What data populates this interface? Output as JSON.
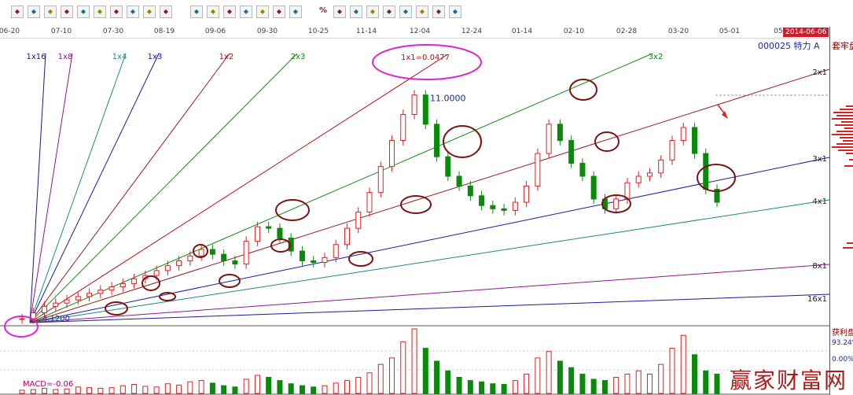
{
  "toolbar": {
    "icons": [
      "chart-toggle-icon",
      "fan-line-icon",
      "arrow-icon",
      "pointer-icon",
      "diamond-icon",
      "diamond-icon",
      "diamond-icon",
      "diamond-icon",
      "diamond-icon",
      "cycle-icon",
      "grid-icon",
      "line-tool-icon",
      "parallel-icon",
      "channel-icon",
      "ellipse-icon",
      "fibonacci-icon",
      "gann-icon",
      "percent-icon",
      "text-icon",
      "target-icon",
      "palette-icon",
      "price-tag-icon",
      "rise-icon",
      "fall-icon",
      "erase-icon",
      "lock-icon"
    ],
    "percent_label": "%"
  },
  "date_axis": {
    "labels": [
      "06-20",
      "07-10",
      "07-30",
      "08-19",
      "09-06",
      "09-30",
      "10-25",
      "11-14",
      "12-04",
      "12-24",
      "01-14",
      "02-10",
      "02-28",
      "03-20",
      "05-01",
      "05"
    ],
    "current_date": "2014-06-06"
  },
  "stock": {
    "code_name": "000025  特力 A"
  },
  "right_panel": {
    "title": "套牢盘",
    "title2": "获利盘",
    "pct1": "93.24%",
    "pct2": "0.00%"
  },
  "macd": {
    "label": "MACD=-0.06"
  },
  "watermark": "赢家财富网",
  "colors": {
    "up": "#e02020",
    "down": "#0a8a0a",
    "annot_circle": "#7a1414",
    "origin_circle": "#e020e0"
  },
  "chart_data": {
    "type": "candlestick-gann-fan",
    "note_labels": {
      "peak_price": "11.0000",
      "origin_price": "4.1200",
      "fan_main": "1x1=0.0477",
      "fan_upper": [
        "1x16",
        "1x8",
        "1x4",
        "1x3",
        "1x2",
        "2x3",
        "3x2"
      ],
      "fan_lower": [
        "2x1",
        "3x1",
        "4x1",
        "8x1",
        "16x1"
      ]
    },
    "ylim": [
      4.0,
      11.5
    ],
    "price_path": [
      4.12,
      4.3,
      4.5,
      4.6,
      4.7,
      4.8,
      4.9,
      5.0,
      5.1,
      5.2,
      5.35,
      5.45,
      5.6,
      5.75,
      5.9,
      6.05,
      6.25,
      6.1,
      5.9,
      5.8,
      6.5,
      6.95,
      6.9,
      6.6,
      6.2,
      5.9,
      5.85,
      6.0,
      6.4,
      6.9,
      7.4,
      8.0,
      8.8,
      9.6,
      10.4,
      11.0,
      10.1,
      9.1,
      8.5,
      8.2,
      7.9,
      7.6,
      7.5,
      7.45,
      7.7,
      8.2,
      9.2,
      10.1,
      9.6,
      8.9,
      8.5,
      7.8,
      7.5,
      7.8,
      8.3,
      8.5,
      8.6,
      9.0,
      9.6,
      10.0,
      9.2,
      8.1,
      7.7
    ],
    "volume_path": [
      0.05,
      0.06,
      0.08,
      0.06,
      0.07,
      0.1,
      0.09,
      0.08,
      0.09,
      0.12,
      0.14,
      0.11,
      0.1,
      0.15,
      0.13,
      0.18,
      0.2,
      0.16,
      0.12,
      0.1,
      0.22,
      0.28,
      0.25,
      0.2,
      0.15,
      0.12,
      0.1,
      0.12,
      0.16,
      0.2,
      0.25,
      0.32,
      0.45,
      0.55,
      0.8,
      1.0,
      0.7,
      0.5,
      0.35,
      0.25,
      0.2,
      0.18,
      0.15,
      0.14,
      0.2,
      0.3,
      0.55,
      0.65,
      0.5,
      0.4,
      0.3,
      0.22,
      0.2,
      0.25,
      0.3,
      0.35,
      0.3,
      0.45,
      0.7,
      0.9,
      0.6,
      0.35,
      0.3
    ]
  }
}
